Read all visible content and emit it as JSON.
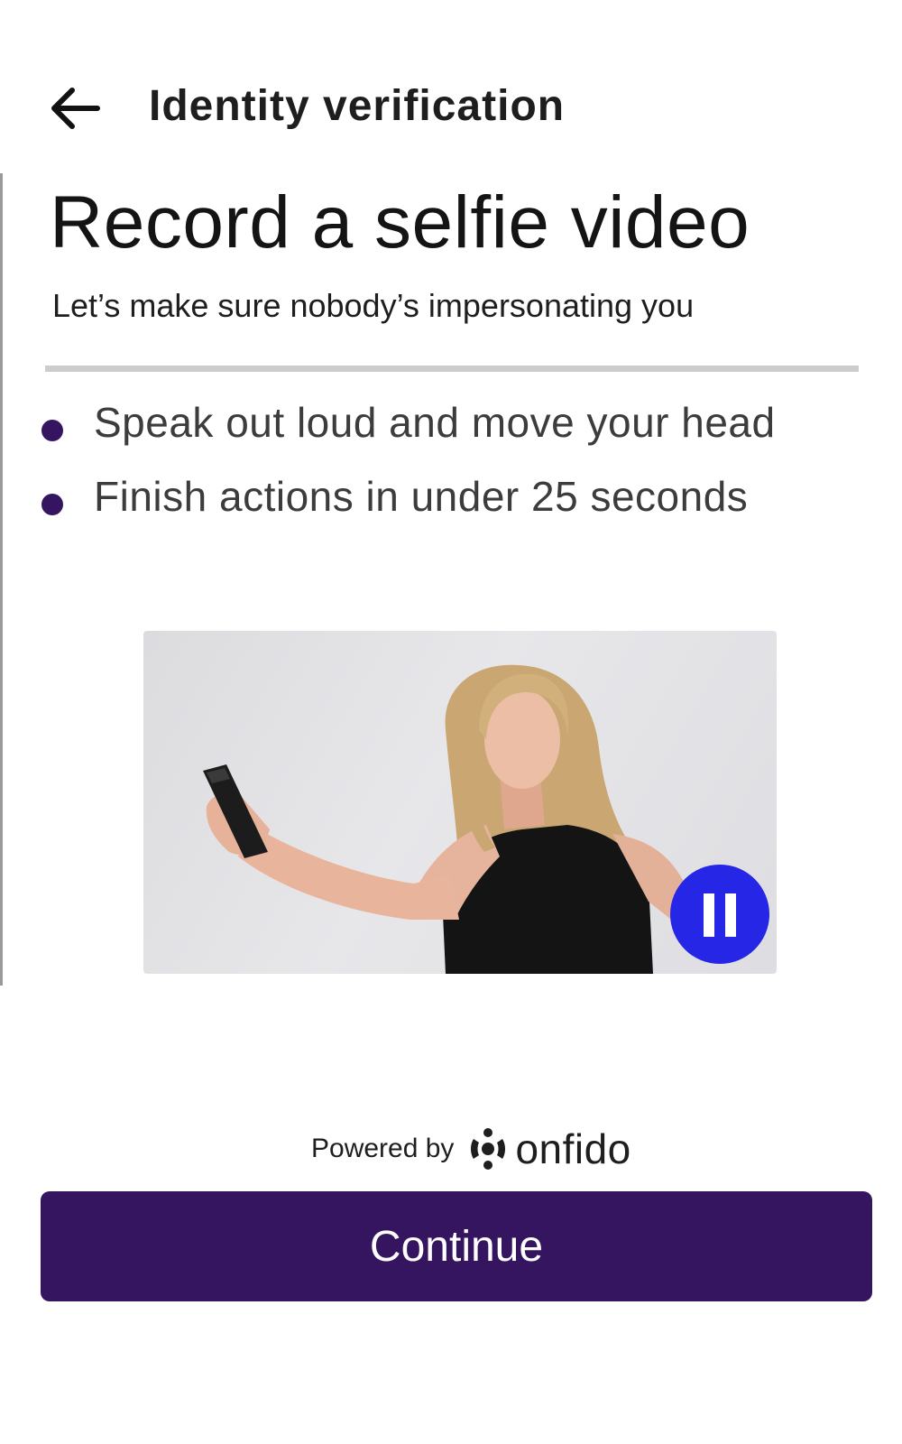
{
  "header": {
    "back_icon": "arrow-left-icon",
    "title": "Identity verification"
  },
  "content": {
    "title": "Record a selfie video",
    "subtitle": "Let’s make sure nobody’s impersonating you",
    "instructions": [
      {
        "text": "Speak out loud and move your head"
      },
      {
        "text": "Finish actions in under 25 seconds"
      }
    ]
  },
  "video": {
    "pause_icon": "pause-icon"
  },
  "footer": {
    "powered_by": "Powered by",
    "brand": "onfido",
    "continue_label": "Continue"
  },
  "colors": {
    "primary": "#35155f",
    "pause_button": "#2626e6",
    "divider": "#cccccc"
  }
}
